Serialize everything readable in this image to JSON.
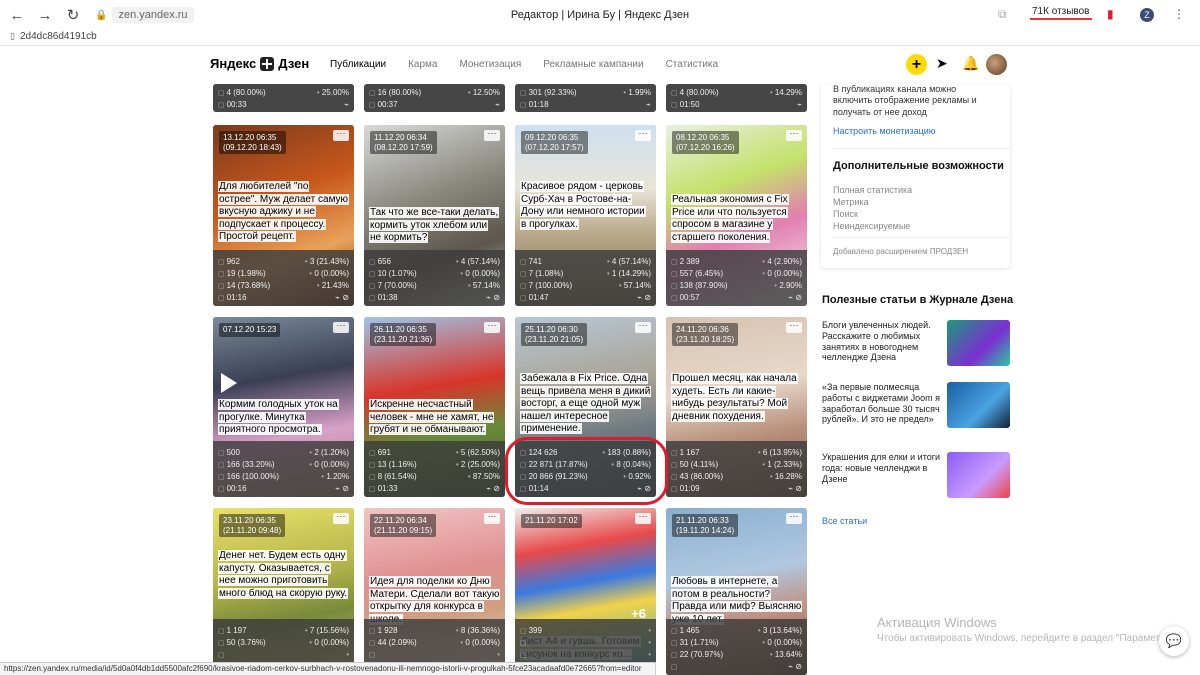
{
  "browser": {
    "url": "zen.yandex.ru",
    "tab_title": "Редактор | Ирина Бу | Яндекс Дзен",
    "reviews": "71К отзывов",
    "hash": "2d4dc86d4191cb",
    "status_url": "https://zen.yandex.ru/media/id/5d0a0f4db1dd5500afc2f690/krasivoe-riadom-cerkov-surbhach-v-rostovenadonu-ili-nemnogo-istorii-v-progulkah-5fce23acadaafd0e72665?from=editor"
  },
  "header": {
    "logo": "Яндекс",
    "logo2": "Дзен",
    "menu": [
      "Публикации",
      "Карма",
      "Монетизация",
      "Рекламные кампании",
      "Статистика"
    ],
    "plus": "+"
  },
  "top_strip": [
    {
      "r1l": "4 (80.00%)",
      "r1r": "25.00%",
      "r2l": "00:33"
    },
    {
      "r1l": "16 (80.00%)",
      "r1r": "12.50%",
      "r2l": "00:37"
    },
    {
      "r1l": "301 (92.33%)",
      "r1r": "1.99%",
      "r2l": "01:18"
    },
    {
      "r1l": "4 (80.00%)",
      "r1r": "14.29%",
      "r2l": "01:50"
    }
  ],
  "cards": [
    {
      "date": "13.12.20 06:35\n(09.12.20 18:43)",
      "title": "Для любителей \"по острее\". Муж делает самую вкусную аджику и не подпускает к процессу. Простой рецепт.",
      "s": [
        [
          "962",
          "3 (21.43%)"
        ],
        [
          "19 (1.98%)",
          "0 (0.00%)"
        ],
        [
          "14 (73.68%)",
          "21.43%"
        ],
        [
          "01:16",
          ""
        ]
      ]
    },
    {
      "date": "11.12.20 06:34\n(08.12.20 17:59)",
      "title": "Так что же все-таки делать, кормить уток хлебом или не кормить?",
      "s": [
        [
          "656",
          "4 (57.14%)"
        ],
        [
          "10 (1.07%)",
          "0 (0.00%)"
        ],
        [
          "7 (70.00%)",
          "57.14%"
        ],
        [
          "01:38",
          ""
        ]
      ]
    },
    {
      "date": "09.12.20 06:35\n(07.12.20 17:57)",
      "title": "Красивое рядом - церковь Сурб-Хач в Ростове-на-Дону или немного истории в прогулках.",
      "s": [
        [
          "741",
          "4 (57.14%)"
        ],
        [
          "7 (1.08%)",
          "1 (14.29%)"
        ],
        [
          "7 (100.00%)",
          "57.14%"
        ],
        [
          "01:47",
          ""
        ]
      ]
    },
    {
      "date": "08.12.20 06:35\n(07.12.20 16:26)",
      "title": "Реальная экономия с Fix Price или что пользуется спросом в магазине у старшего поколения.",
      "s": [
        [
          "2 389",
          "4 (2.90%)"
        ],
        [
          "557 (6.45%)",
          "0 (0.00%)"
        ],
        [
          "138 (87.90%)",
          "2.90%"
        ],
        [
          "00:57",
          ""
        ]
      ]
    },
    {
      "date": "07.12.20 15:23",
      "title": "Кормим голодных уток на прогулке. Минутка приятного просмотра.",
      "s": [
        [
          "500",
          "2 (1.20%)"
        ],
        [
          "166 (33.20%)",
          "0 (0.00%)"
        ],
        [
          "166 (100.00%)",
          "1.20%"
        ],
        [
          "00:16",
          ""
        ]
      ]
    },
    {
      "date": "26.11.20 06:35\n(23.11.20 21:36)",
      "title": "Искренне несчастный человек - мне не хамят, не грубят и не обманывают.",
      "s": [
        [
          "691",
          "5 (62.50%)"
        ],
        [
          "13 (1.16%)",
          "2 (25.00%)"
        ],
        [
          "8 (61.54%)",
          "87.50%"
        ],
        [
          "01:33",
          ""
        ]
      ]
    },
    {
      "date": "25.11.20 06:30\n(23.11.20 21:05)",
      "title": "Забежала в Fix Price. Одна вещь привела меня в дикий восторг, а еще одной муж нашел интересное применение.",
      "s": [
        [
          "124 626",
          "183 (0.88%)"
        ],
        [
          "22 871 (17.87%)",
          "8 (0.04%)"
        ],
        [
          "20 866 (91.23%)",
          "0.92%"
        ],
        [
          "01:14",
          ""
        ]
      ]
    },
    {
      "date": "24.11.20 06:36\n(23.11.20 18:25)",
      "title": "Прошел месяц, как начала худеть. Есть ли какие-нибудь результаты? Мой дневник похудения.",
      "s": [
        [
          "1 167",
          "6 (13.95%)"
        ],
        [
          "50 (4.11%)",
          "1 (2.33%)"
        ],
        [
          "43 (86.00%)",
          "16.28%"
        ],
        [
          "01:09",
          ""
        ]
      ]
    },
    {
      "date": "23.11.20 06:35\n(21.11.20 09:48)",
      "title": "Денег нет. Будем есть одну капусту. Оказывается, с нее можно приготовить много блюд на скорую руку.",
      "s": [
        [
          "1 197",
          "7 (15.56%)"
        ],
        [
          "50 (3.76%)",
          "0 (0.00%)"
        ],
        [
          "",
          ""
        ],
        [
          "",
          ""
        ]
      ]
    },
    {
      "date": "22.11.20 06:34\n(21.11.20 09:15)",
      "title": "Идея для поделки ко Дню Матери. Сделали вот такую открытку для конкурса в школе.",
      "s": [
        [
          "1 928",
          "8 (36.36%)"
        ],
        [
          "44 (2.09%)",
          "0 (0.00%)"
        ],
        [
          "",
          ""
        ],
        [
          "",
          ""
        ]
      ]
    },
    {
      "date": "21.11.20 17:02",
      "title": "Лист А4 и гуашь. Готовим рисунок на конкурс ко...",
      "s": [
        [
          "399",
          ""
        ],
        [
          "",
          ""
        ],
        [
          "",
          ""
        ],
        [
          "",
          ""
        ]
      ]
    },
    {
      "date": "21.11.20 06:33\n(19.11.20 14:24)",
      "title": "Любовь в интернете, а потом в реальности? Правда или миф? Выясняю уже 10 лет.",
      "s": [
        [
          "1 465",
          "3 (13.64%)"
        ],
        [
          "31 (1.71%)",
          "0 (0.00%)"
        ],
        [
          "22 (70.97%)",
          "13.64%"
        ],
        [
          "",
          ""
        ]
      ]
    }
  ],
  "sidebar": {
    "monet_text": "В публикациях канала можно включить отображение рекламы и получать от нее доход",
    "monet_link": "Настроить монетизацию",
    "extra_title": "Дополнительные возможности",
    "extra_items": [
      "Полная статистика",
      "Метрика",
      "Поиск",
      "Неиндексируемые"
    ],
    "added_by": "Добавлено расширением ПРОДЗЕН",
    "journal_title": "Полезные статьи в Журнале Дзена",
    "journal": [
      "Блоги увлеченных людей. Расскажите о любимых занятиях в новогоднем челлендже Дзена",
      "«За первые полмесяца работы с виджетами Joom я заработал больше 30 тысяч рублей». И это не предел»",
      "Украшения для елки и итоги года: новые челленджи в Дзене"
    ],
    "all_link": "Все статьи"
  },
  "watermark": {
    "line1": "Активация Windows",
    "line2": "Чтобы активировать Windows, перейдите в раздел \"Параметры\"."
  },
  "plus6": "+6"
}
